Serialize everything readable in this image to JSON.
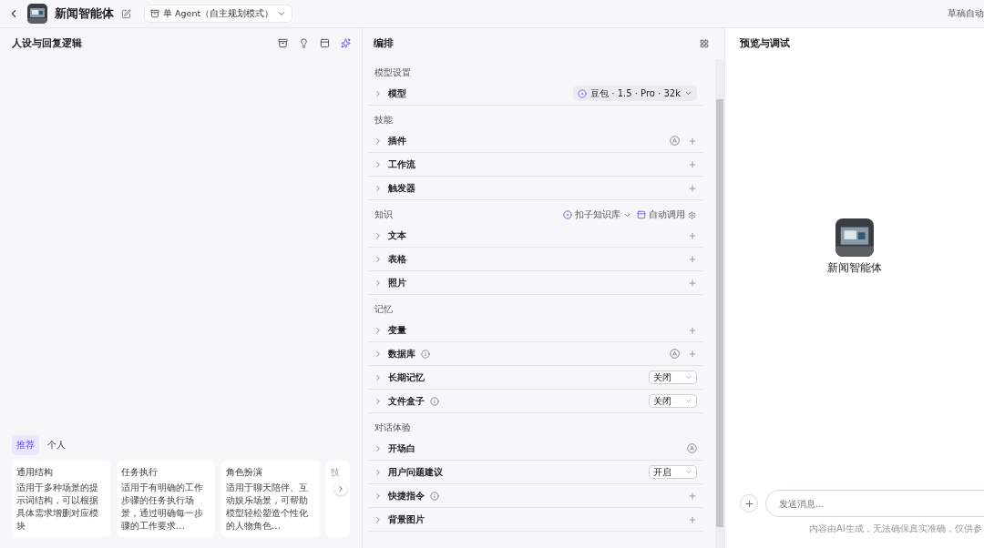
{
  "topbar": {
    "agent_name": "新闻智能体",
    "mode": "单 Agent（自主规划模式）",
    "status": "草稿自动"
  },
  "persona_panel": {
    "title": "人设与回复逻辑",
    "tabs": [
      {
        "label": "推荐",
        "selected": true
      },
      {
        "label": "个人",
        "selected": false
      }
    ],
    "templates": [
      {
        "title": "通用结构",
        "description": "适用于多种场景的提示词结构，可以根据具体需求增删对应模块"
      },
      {
        "title": "任务执行",
        "description": "适用于有明确的工作步骤的任务执行场景，通过明确每一步骤的工作要求…"
      },
      {
        "title": "角色扮演",
        "description": "适用于聊天陪伴、互动娱乐场景，可帮助模型轻松塑造个性化的人物角色…"
      },
      {
        "title": "技"
      }
    ]
  },
  "arrange_panel": {
    "title": "编排",
    "sections": [
      {
        "title": "模型设置",
        "items": [
          {
            "label": "模型",
            "kind": "model",
            "value": "豆包 · 1.5 · Pro · 32k"
          }
        ]
      },
      {
        "title": "技能",
        "items": [
          {
            "label": "插件",
            "kind": "auto_add",
            "info": false
          },
          {
            "label": "工作流",
            "kind": "add",
            "info": false
          },
          {
            "label": "触发器",
            "kind": "add",
            "info": false
          }
        ]
      },
      {
        "title": "知识",
        "source": "扣子知识库",
        "call_mode": "自动调用",
        "items": [
          {
            "label": "文本",
            "kind": "add",
            "info": false
          },
          {
            "label": "表格",
            "kind": "add",
            "info": false
          },
          {
            "label": "照片",
            "kind": "add",
            "info": false
          }
        ]
      },
      {
        "title": "记忆",
        "items": [
          {
            "label": "变量",
            "kind": "add",
            "info": false
          },
          {
            "label": "数据库",
            "kind": "auto_add",
            "info": true
          },
          {
            "label": "长期记忆",
            "kind": "select",
            "value": "关闭",
            "info": false
          },
          {
            "label": "文件盒子",
            "kind": "select",
            "value": "关闭",
            "info": true
          }
        ]
      },
      {
        "title": "对话体验",
        "items": [
          {
            "label": "开场白",
            "kind": "auto",
            "info": false
          },
          {
            "label": "用户问题建议",
            "kind": "select",
            "value": "开启",
            "info": false
          },
          {
            "label": "快捷指令",
            "kind": "add",
            "info": true
          },
          {
            "label": "背景图片",
            "kind": "add",
            "info": false
          }
        ]
      }
    ]
  },
  "preview_panel": {
    "title": "预览与调试",
    "agent_name": "新闻智能体",
    "input": {
      "placeholder": "发送消息..."
    },
    "disclaimer": "内容由AI生成，无法确保真实准确，仅供参"
  }
}
